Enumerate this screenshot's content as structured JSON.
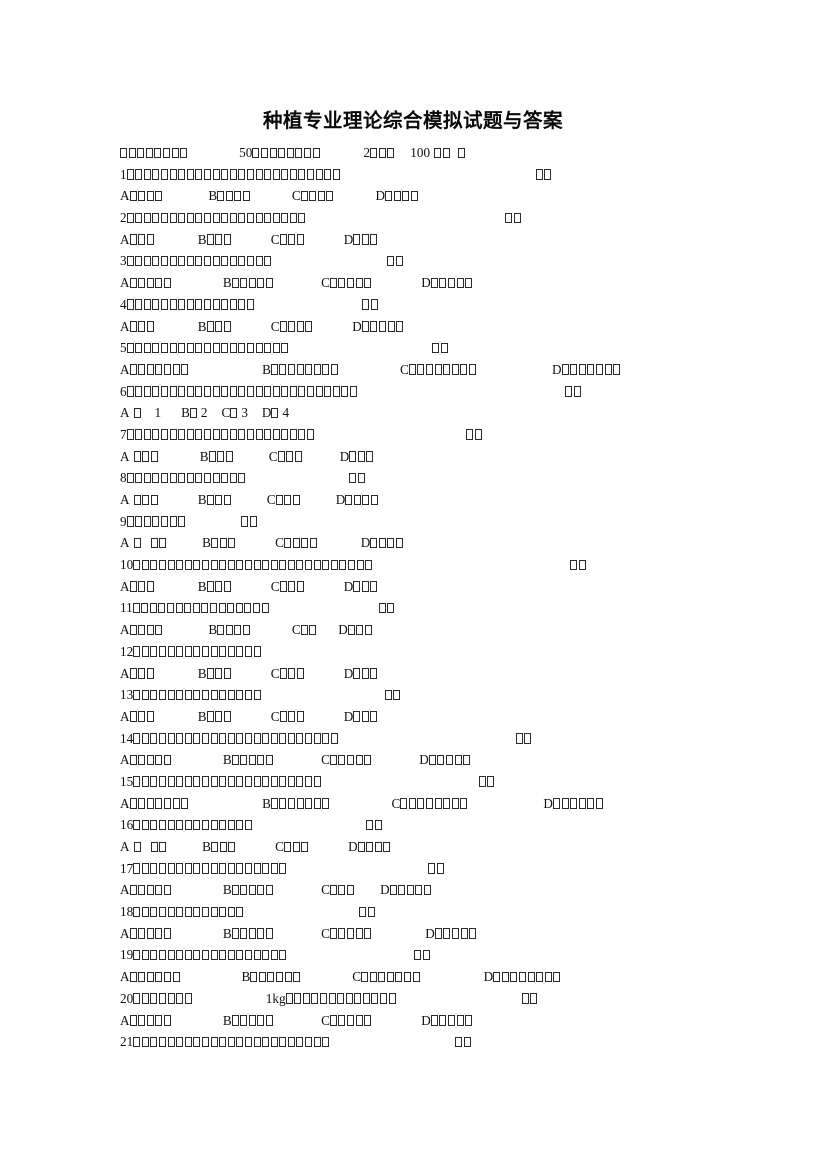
{
  "document": {
    "title": "种植专业理论综合模拟试题与答案",
    "page_background": "#ffffff",
    "text_color": "#111111",
    "note": "All CJK body characters render as missing-glyph (tofu) boxes; Latin letters and digits render normally."
  },
  "header_line": {
    "segments": [
      {
        "type": "tofu",
        "count": 8
      },
      {
        "type": "gap",
        "width": 52
      },
      {
        "type": "text",
        "value": "50"
      },
      {
        "type": "tofu",
        "count": 8
      },
      {
        "type": "gap",
        "width": 44
      },
      {
        "type": "text",
        "value": "2"
      },
      {
        "type": "tofu",
        "count": 3
      },
      {
        "type": "gap",
        "width": 16
      },
      {
        "type": "text",
        "value": "100"
      },
      {
        "type": "gap",
        "width": 4
      },
      {
        "type": "tofu",
        "count": 2
      },
      {
        "type": "gap",
        "width": 8
      },
      {
        "type": "tofu",
        "count": 1
      }
    ]
  },
  "questions": [
    {
      "number": "1",
      "stem_tofu": 25,
      "stem_gap": 196,
      "paren_tofu": 2,
      "options": [
        {
          "letter": "A",
          "space": false,
          "tofu": 4,
          "gap": 46
        },
        {
          "letter": "B",
          "space": false,
          "tofu": 4,
          "gap": 42
        },
        {
          "letter": "C",
          "space": false,
          "tofu": 4,
          "gap": 42
        },
        {
          "letter": "D",
          "space": false,
          "tofu": 4,
          "gap": 0
        }
      ]
    },
    {
      "number": "2",
      "stem_tofu": 21,
      "stem_gap": 200,
      "paren_tofu": 2,
      "options": [
        {
          "letter": "A",
          "space": false,
          "tofu": 3,
          "gap": 44
        },
        {
          "letter": "B",
          "space": false,
          "tofu": 3,
          "gap": 40
        },
        {
          "letter": "C",
          "space": false,
          "tofu": 3,
          "gap": 40
        },
        {
          "letter": "D",
          "space": false,
          "tofu": 3,
          "gap": 0
        }
      ]
    },
    {
      "number": "3",
      "stem_tofu": 17,
      "stem_gap": 116,
      "paren_tofu": 2,
      "options": [
        {
          "letter": "A",
          "space": false,
          "tofu": 5,
          "gap": 52
        },
        {
          "letter": "B",
          "space": false,
          "tofu": 5,
          "gap": 48
        },
        {
          "letter": "C",
          "space": false,
          "tofu": 5,
          "gap": 50
        },
        {
          "letter": "D",
          "space": false,
          "tofu": 5,
          "gap": 0
        }
      ]
    },
    {
      "number": "4",
      "stem_tofu": 15,
      "stem_gap": 108,
      "paren_tofu": 2,
      "options": [
        {
          "letter": "A",
          "space": false,
          "tofu": 3,
          "gap": 44
        },
        {
          "letter": "B",
          "space": false,
          "tofu": 3,
          "gap": 40
        },
        {
          "letter": "C",
          "space": false,
          "tofu": 4,
          "gap": 40
        },
        {
          "letter": "D",
          "space": false,
          "tofu": 5,
          "gap": 0
        }
      ]
    },
    {
      "number": "5",
      "stem_tofu": 19,
      "stem_gap": 144,
      "paren_tofu": 2,
      "options": [
        {
          "letter": "A",
          "space": false,
          "tofu": 7,
          "gap": 74
        },
        {
          "letter": "B",
          "space": false,
          "tofu": 8,
          "gap": 62
        },
        {
          "letter": "C",
          "space": false,
          "tofu": 8,
          "gap": 76
        },
        {
          "letter": "D",
          "space": false,
          "tofu": 7,
          "gap": 0
        }
      ]
    },
    {
      "number": "6",
      "stem_tofu": 27,
      "stem_gap": 208,
      "paren_tofu": 2,
      "options": [
        {
          "letter": "A",
          "space": true,
          "tofu": 1,
          "gap": 14,
          "suffix": "1",
          "suffix_gap": 20
        },
        {
          "letter": "B",
          "space": false,
          "tofu": 1,
          "gap": 4,
          "suffix": "2",
          "suffix_gap": 14
        },
        {
          "letter": "C",
          "space": false,
          "tofu": 1,
          "gap": 4,
          "suffix": "3",
          "suffix_gap": 14
        },
        {
          "letter": "D",
          "space": false,
          "tofu": 1,
          "gap": 4,
          "suffix": "4",
          "suffix_gap": 0
        }
      ]
    },
    {
      "number": "7",
      "stem_tofu": 22,
      "stem_gap": 152,
      "paren_tofu": 2,
      "options": [
        {
          "letter": "A",
          "space": true,
          "tofu": 3,
          "gap": 42
        },
        {
          "letter": "B",
          "space": false,
          "tofu": 3,
          "gap": 36
        },
        {
          "letter": "C",
          "space": false,
          "tofu": 3,
          "gap": 38
        },
        {
          "letter": "D",
          "space": false,
          "tofu": 3,
          "gap": 0
        }
      ]
    },
    {
      "number": "8",
      "stem_tofu": 14,
      "stem_gap": 104,
      "paren_tofu": 2,
      "options": [
        {
          "letter": "A",
          "space": true,
          "tofu": 3,
          "gap": 40
        },
        {
          "letter": "B",
          "space": false,
          "tofu": 3,
          "gap": 36
        },
        {
          "letter": "C",
          "space": false,
          "tofu": 3,
          "gap": 36
        },
        {
          "letter": "D",
          "space": false,
          "tofu": 4,
          "gap": 0
        }
      ]
    },
    {
      "number": "9",
      "stem_tofu": 7,
      "stem_gap": 56,
      "paren_tofu": 2,
      "options": [
        {
          "letter": "A",
          "space": true,
          "tofu": 1,
          "gap": 10,
          "extra_tofu": 2,
          "gap2": 36
        },
        {
          "letter": "B",
          "space": false,
          "tofu": 3,
          "gap": 40
        },
        {
          "letter": "C",
          "space": false,
          "tofu": 4,
          "gap": 44
        },
        {
          "letter": "D",
          "space": false,
          "tofu": 4,
          "gap": 0
        }
      ]
    },
    {
      "number": "10",
      "stem_tofu": 28,
      "stem_gap": 198,
      "paren_tofu": 2,
      "options": [
        {
          "letter": "A",
          "space": false,
          "tofu": 3,
          "gap": 44
        },
        {
          "letter": "B",
          "space": false,
          "tofu": 3,
          "gap": 40
        },
        {
          "letter": "C",
          "space": false,
          "tofu": 3,
          "gap": 40
        },
        {
          "letter": "D",
          "space": false,
          "tofu": 3,
          "gap": 0
        }
      ]
    },
    {
      "number": "11",
      "stem_tofu": 16,
      "stem_gap": 110,
      "paren_tofu": 2,
      "options": [
        {
          "letter": "A",
          "space": false,
          "tofu": 4,
          "gap": 46
        },
        {
          "letter": "B",
          "space": false,
          "tofu": 4,
          "gap": 42
        },
        {
          "letter": "C",
          "space": false,
          "tofu": 2,
          "gap": 22
        },
        {
          "letter": "D",
          "space": false,
          "tofu": 3,
          "gap": 0
        }
      ]
    },
    {
      "number": "12",
      "stem_tofu": 15,
      "stem_gap": 0,
      "paren_tofu": 0,
      "options": [
        {
          "letter": "A",
          "space": false,
          "tofu": 3,
          "gap": 44
        },
        {
          "letter": "B",
          "space": false,
          "tofu": 3,
          "gap": 40
        },
        {
          "letter": "C",
          "space": false,
          "tofu": 3,
          "gap": 40
        },
        {
          "letter": "D",
          "space": false,
          "tofu": 3,
          "gap": 0
        }
      ]
    },
    {
      "number": "13",
      "stem_tofu": 15,
      "stem_gap": 124,
      "paren_tofu": 2,
      "options": [
        {
          "letter": "A",
          "space": false,
          "tofu": 3,
          "gap": 44
        },
        {
          "letter": "B",
          "space": false,
          "tofu": 3,
          "gap": 40
        },
        {
          "letter": "C",
          "space": false,
          "tofu": 3,
          "gap": 40
        },
        {
          "letter": "D",
          "space": false,
          "tofu": 3,
          "gap": 0
        }
      ]
    },
    {
      "number": "14",
      "stem_tofu": 24,
      "stem_gap": 178,
      "paren_tofu": 2,
      "options": [
        {
          "letter": "A",
          "space": false,
          "tofu": 5,
          "gap": 52
        },
        {
          "letter": "B",
          "space": false,
          "tofu": 5,
          "gap": 48
        },
        {
          "letter": "C",
          "space": false,
          "tofu": 5,
          "gap": 48
        },
        {
          "letter": "D",
          "space": false,
          "tofu": 5,
          "gap": 0
        }
      ]
    },
    {
      "number": "15",
      "stem_tofu": 22,
      "stem_gap": 158,
      "paren_tofu": 2,
      "options": [
        {
          "letter": "A",
          "space": false,
          "tofu": 7,
          "gap": 74
        },
        {
          "letter": "B",
          "space": false,
          "tofu": 7,
          "gap": 62
        },
        {
          "letter": "C",
          "space": false,
          "tofu": 8,
          "gap": 76
        },
        {
          "letter": "D",
          "space": false,
          "tofu": 6,
          "gap": 0
        }
      ]
    },
    {
      "number": "16",
      "stem_tofu": 14,
      "stem_gap": 114,
      "paren_tofu": 2,
      "options": [
        {
          "letter": "A",
          "space": true,
          "tofu": 1,
          "gap": 10,
          "extra_tofu": 2,
          "gap2": 36
        },
        {
          "letter": "B",
          "space": false,
          "tofu": 3,
          "gap": 40
        },
        {
          "letter": "C",
          "space": false,
          "tofu": 3,
          "gap": 40
        },
        {
          "letter": "D",
          "space": false,
          "tofu": 4,
          "gap": 0
        }
      ]
    },
    {
      "number": "17",
      "stem_tofu": 18,
      "stem_gap": 142,
      "paren_tofu": 2,
      "options": [
        {
          "letter": "A",
          "space": false,
          "tofu": 5,
          "gap": 52
        },
        {
          "letter": "B",
          "space": false,
          "tofu": 5,
          "gap": 48
        },
        {
          "letter": "C",
          "space": false,
          "tofu": 3,
          "gap": 26
        },
        {
          "letter": "D",
          "space": false,
          "tofu": 5,
          "gap": 0
        }
      ]
    },
    {
      "number": "18",
      "stem_tofu": 13,
      "stem_gap": 116,
      "paren_tofu": 2,
      "options": [
        {
          "letter": "A",
          "space": false,
          "tofu": 5,
          "gap": 52
        },
        {
          "letter": "B",
          "space": false,
          "tofu": 5,
          "gap": 48
        },
        {
          "letter": "C",
          "space": false,
          "tofu": 5,
          "gap": 54
        },
        {
          "letter": "D",
          "space": false,
          "tofu": 5,
          "gap": 0
        }
      ]
    },
    {
      "number": "19",
      "stem_tofu": 18,
      "stem_gap": 128,
      "paren_tofu": 2,
      "options": [
        {
          "letter": "A",
          "space": false,
          "tofu": 6,
          "gap": 62
        },
        {
          "letter": "B",
          "space": false,
          "tofu": 6,
          "gap": 52
        },
        {
          "letter": "C",
          "space": false,
          "tofu": 7,
          "gap": 64
        },
        {
          "letter": "D",
          "space": false,
          "tofu": 8,
          "gap": 0
        }
      ]
    },
    {
      "number": "20",
      "stem_tofu": 7,
      "stem_gap": 74,
      "stem_text": "1kg",
      "stem_tofu2": 13,
      "stem_gap2": 126,
      "paren_tofu": 2,
      "options": [
        {
          "letter": "A",
          "space": false,
          "tofu": 5,
          "gap": 52
        },
        {
          "letter": "B",
          "space": false,
          "tofu": 5,
          "gap": 48
        },
        {
          "letter": "C",
          "space": false,
          "tofu": 5,
          "gap": 50
        },
        {
          "letter": "D",
          "space": false,
          "tofu": 5,
          "gap": 0
        }
      ]
    },
    {
      "number": "21",
      "stem_tofu": 23,
      "stem_gap": 126,
      "paren_tofu": 2,
      "options": []
    }
  ]
}
